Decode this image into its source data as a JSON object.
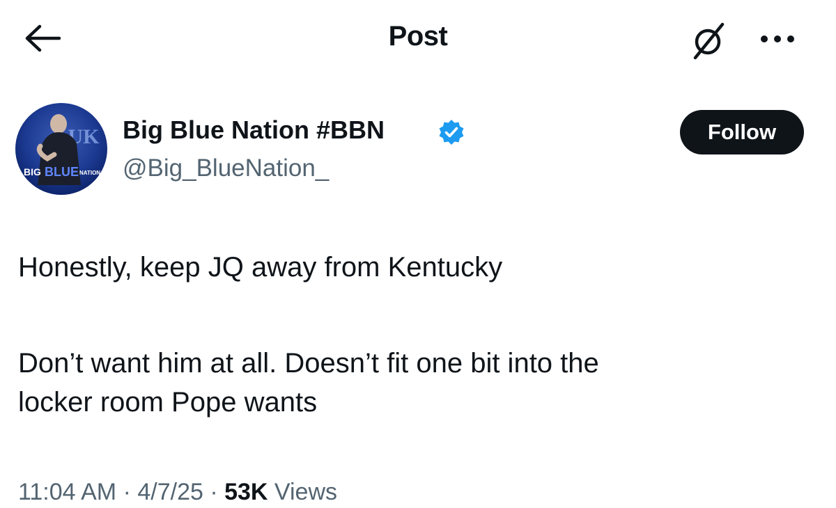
{
  "header": {
    "title": "Post",
    "back_icon": "arrow-left-icon",
    "grok_icon": "grok-icon",
    "more_icon": "more-horizontal-icon"
  },
  "author": {
    "display_name": "Big Blue Nation #BBN",
    "handle": "@Big_BlueNation_",
    "verified": true,
    "verified_color": "#1d9bf0",
    "avatar_text": {
      "big": "BIG",
      "blue": "BLUE",
      "nation": "NATION",
      "uk": "UK"
    },
    "follow_label": "Follow"
  },
  "tweet": {
    "lines": [
      "Honestly, keep JQ away from Kentucky",
      "Don’t want him at all. Doesn’t fit one bit into the",
      "locker room Pope wants"
    ]
  },
  "meta": {
    "time": "11:04 AM",
    "sep1": " · ",
    "date": "4/7/25",
    "sep2": " · ",
    "views_count": "53K",
    "views_label": " Views"
  },
  "colors": {
    "text": "#0f1419",
    "secondary": "#536471",
    "accent": "#1d9bf0",
    "follow_bg": "#0f1419"
  }
}
